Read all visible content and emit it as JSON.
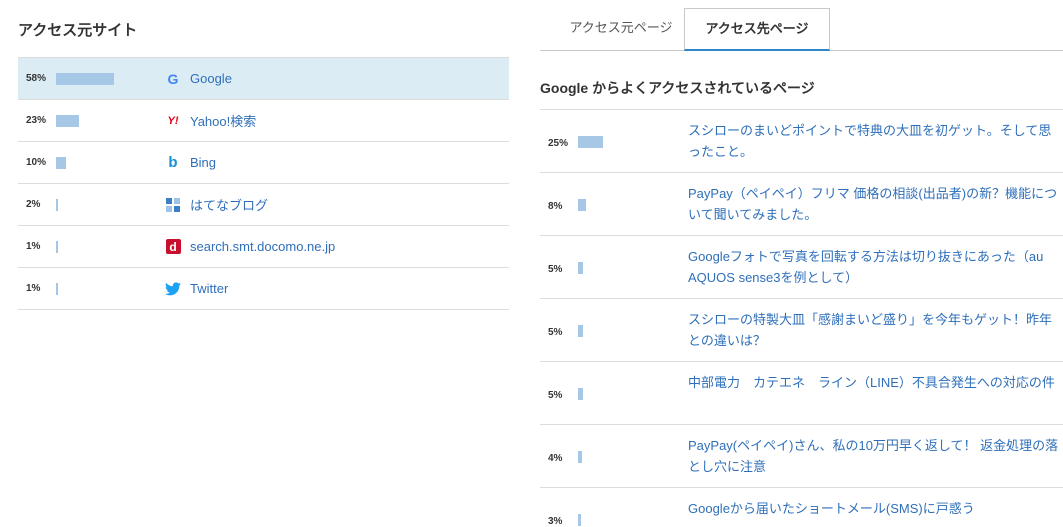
{
  "left": {
    "title": "アクセス元サイト",
    "sources": [
      {
        "pct": "58%",
        "value": 58,
        "name": "Google",
        "icon": "google-icon",
        "active": true
      },
      {
        "pct": "23%",
        "value": 23,
        "name": "Yahoo!検索",
        "icon": "yahoo-icon",
        "active": false
      },
      {
        "pct": "10%",
        "value": 10,
        "name": "Bing",
        "icon": "bing-icon",
        "active": false
      },
      {
        "pct": "2%",
        "value": 2,
        "name": "はてなブログ",
        "icon": "hatena-blog-icon",
        "active": false
      },
      {
        "pct": "1%",
        "value": 1,
        "name": "search.smt.docomo.ne.jp",
        "icon": "docomo-icon",
        "active": false
      },
      {
        "pct": "1%",
        "value": 1,
        "name": "Twitter",
        "icon": "twitter-icon",
        "active": false
      }
    ],
    "icon_glyphs": {
      "google": "G",
      "yahoo": "Y!",
      "bing": "b",
      "docomo": "d"
    }
  },
  "right": {
    "tabs": [
      {
        "label": "アクセス元ページ",
        "active": false
      },
      {
        "label": "アクセス先ページ",
        "active": true
      }
    ],
    "heading": "Google からよくアクセスされているページ",
    "pages": [
      {
        "pct": "25%",
        "value": 25,
        "title": "スシローのまいどポイントで特典の大皿を初ゲット。そして思ったこと。"
      },
      {
        "pct": "8%",
        "value": 8,
        "title": "PayPay（ペイペイ）フリマ 価格の相談(出品者)の新？機能について聞いてみました。"
      },
      {
        "pct": "5%",
        "value": 5,
        "title": "Googleフォトで写真を回転する方法は切り抜きにあった（au AQUOS sense3を例として）"
      },
      {
        "pct": "5%",
        "value": 5,
        "title": "スシローの特製大皿「感謝まいど盛り」を今年もゲット！昨年との違いは？"
      },
      {
        "pct": "5%",
        "value": 5,
        "title": "中部電力　カテエネ　ライン（LINE）不具合発生への対応の件"
      },
      {
        "pct": "4%",
        "value": 4,
        "title": "PayPay(ペイペイ)さん、私の10万円早く返して！ 返金処理の落とし穴に注意"
      },
      {
        "pct": "3%",
        "value": 3,
        "title": "Googleから届いたショートメール(SMS)に戸惑う"
      }
    ]
  },
  "colors": {
    "bar": "#a7c7e7",
    "link": "#2f6fba",
    "active_row": "#dcecf5",
    "tab_underline": "#2f86c9"
  }
}
